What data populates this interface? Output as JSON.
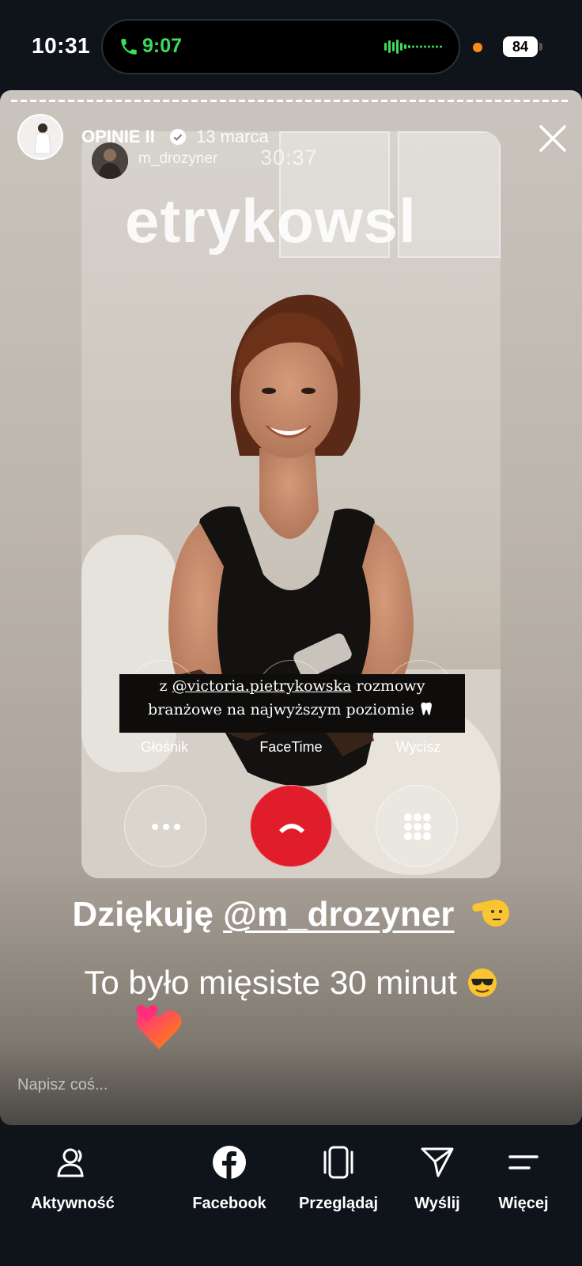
{
  "status": {
    "time": "10:31",
    "call_duration": "9:07",
    "battery": "84"
  },
  "story": {
    "username": "OPINIE II",
    "date": "13 marca",
    "reply_placeholder": "Napisz coś...",
    "thanks_prefix": "Dziękuję ",
    "thanks_mention": "@m_drozyner",
    "second_line": "To było mięsiste 30 minut"
  },
  "inner": {
    "username": "m_drozyner",
    "timer": "30:37",
    "big_name": "etrykowsl",
    "caption_prefix": "z ",
    "caption_mention": "@victoria.pietrykowska",
    "caption_suffix": " rozmowy",
    "caption_line2": "branżowe na najwyższym poziomie",
    "call_labels": [
      "Głośnik",
      "FaceTime",
      "Wycisz"
    ]
  },
  "bottom_nav": [
    {
      "label": "Aktywność",
      "icon": "activity-icon"
    },
    {
      "label": "Facebook",
      "icon": "facebook-icon"
    },
    {
      "label": "Przeglądaj",
      "icon": "browse-icon"
    },
    {
      "label": "Wyślij",
      "icon": "send-icon"
    },
    {
      "label": "Więcej",
      "icon": "more-icon"
    }
  ],
  "colors": {
    "call_green": "#3ddc5a",
    "end_call_red": "#e11d2b",
    "background": "#0f141a"
  }
}
